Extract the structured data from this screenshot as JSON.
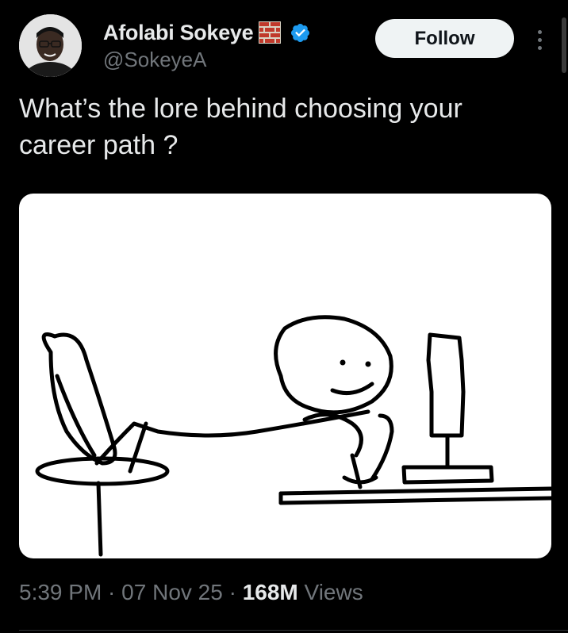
{
  "author": {
    "display_name": "Afolabi Sokeye",
    "handle": "@SokeyeA",
    "emoji_icon": "brick-icon",
    "verified_color": "#1d9bf0"
  },
  "actions": {
    "follow_label": "Follow",
    "more_icon": "more-vertical-icon"
  },
  "tweet": {
    "text": "What’s the lore behind choosing your career path ?",
    "media_icon": "stickman-at-computer-drawing"
  },
  "meta": {
    "time": "5:39 PM",
    "sep1": " · ",
    "date": "07 Nov 25",
    "sep2": " · ",
    "views_count": "168M",
    "views_label": " Views"
  },
  "colors": {
    "background": "#000000",
    "text": "#e7e9ea",
    "secondary": "#71767b",
    "follow_bg": "#eff3f4"
  }
}
